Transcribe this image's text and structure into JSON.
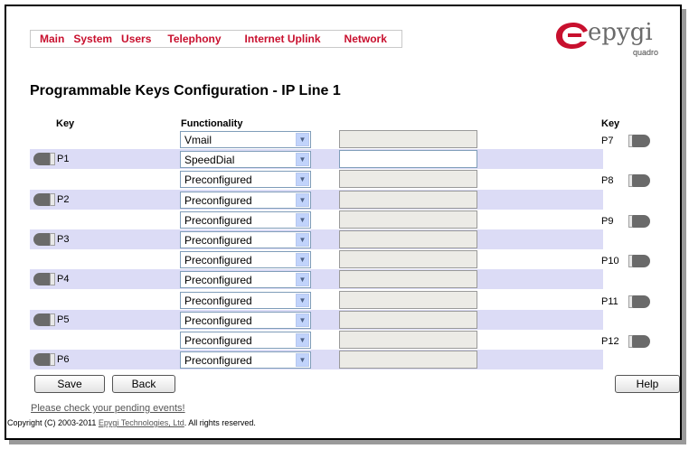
{
  "nav": {
    "items": [
      "Main",
      "System",
      "Users",
      "Telephony",
      "Internet Uplink",
      "Network"
    ]
  },
  "logo": {
    "text": "epygi",
    "sub": "quadro"
  },
  "page": {
    "title": "Programmable Keys Configuration - IP Line 1"
  },
  "table": {
    "headers": {
      "key_left": "Key",
      "functionality": "Functionality",
      "key_right": "Key"
    },
    "rows": [
      {
        "func": "Vmail",
        "right_key": "P7"
      },
      {
        "left_key": "P1",
        "func": "SpeedDial",
        "text_enabled": true
      },
      {
        "func": "Preconfigured",
        "right_key": "P8"
      },
      {
        "left_key": "P2",
        "func": "Preconfigured"
      },
      {
        "func": "Preconfigured",
        "right_key": "P9"
      },
      {
        "left_key": "P3",
        "func": "Preconfigured"
      },
      {
        "func": "Preconfigured",
        "right_key": "P10"
      },
      {
        "left_key": "P4",
        "func": "Preconfigured"
      },
      {
        "func": "Preconfigured",
        "right_key": "P11"
      },
      {
        "left_key": "P5",
        "func": "Preconfigured"
      },
      {
        "func": "Preconfigured",
        "right_key": "P12"
      },
      {
        "left_key": "P6",
        "func": "Preconfigured"
      }
    ]
  },
  "buttons": {
    "save": "Save",
    "back": "Back",
    "help": "Help"
  },
  "footer": {
    "pending_link": "Please check your pending events!",
    "copyright_prefix": "Copyright (C) 2003-2011 ",
    "copyright_link": "Epygi Technologies, Ltd",
    "copyright_suffix": ". All rights reserved."
  },
  "colors": {
    "nav": "#c8102e",
    "row_shade": "#dcdcf6",
    "logo_red": "#c8102e"
  },
  "icons": {
    "led_left": "phone-key-led-icon",
    "led_right": "phone-key-led-icon",
    "dropdown": "chevron-down-icon"
  }
}
